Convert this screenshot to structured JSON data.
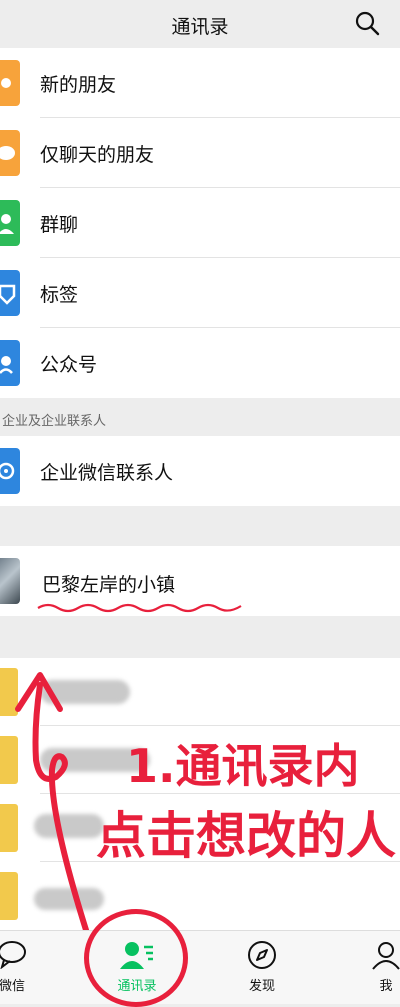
{
  "header": {
    "title": "通讯录"
  },
  "menu": [
    {
      "label": "新的朋友",
      "color": "#f7a33b"
    },
    {
      "label": "仅聊天的朋友",
      "color": "#f7a33b"
    },
    {
      "label": "群聊",
      "color": "#2dbb59"
    },
    {
      "label": "标签",
      "color": "#2e86de"
    },
    {
      "label": "公众号",
      "color": "#2e86de"
    }
  ],
  "section_enterprise": "企业及企业联系人",
  "enterprise_item": {
    "label": "企业微信联系人",
    "color": "#2e86de"
  },
  "contact_item": {
    "label": "巴黎左岸的小镇"
  },
  "annotation": {
    "line1": "1.通讯录内",
    "line2": "点击想改的人"
  },
  "tabbar": [
    {
      "label": "微信",
      "icon": "chat-icon"
    },
    {
      "label": "通讯录",
      "icon": "contacts-icon",
      "active": true,
      "color": "#07c160"
    },
    {
      "label": "发现",
      "icon": "compass-icon"
    },
    {
      "label": "我",
      "icon": "person-icon"
    }
  ],
  "accent_color": "#07c160",
  "annotation_color": "#e8203c"
}
